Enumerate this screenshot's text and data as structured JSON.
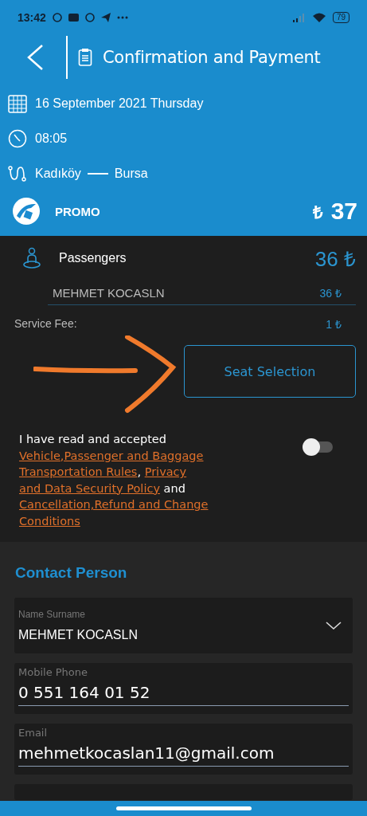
{
  "status_bar": {
    "time": "13:42",
    "battery": "79"
  },
  "header": {
    "title": "Confirmation and Payment"
  },
  "trip": {
    "date": "16 September 2021 Thursday",
    "time": "08:05",
    "from": "Kadıköy",
    "to": "Bursa"
  },
  "promo": {
    "label": "PROMO",
    "currency": "₺",
    "total": "37"
  },
  "passengers": {
    "label": "Passengers",
    "amount": "36 ₺",
    "items": [
      {
        "name": "MEHMET KOCASLN",
        "amount": "36 ₺"
      }
    ]
  },
  "service_fee": {
    "label": "Service Fee:",
    "amount": "1 ₺"
  },
  "seat_button": {
    "label": "Seat Selection"
  },
  "terms": {
    "on": false,
    "parts": [
      {
        "text": "I have read and accepted ",
        "link": false
      },
      {
        "text": "Vehicle,Passenger and Baggage",
        "link": true
      },
      {
        "text": "Transportation Rules",
        "link": true
      },
      {
        "text": ", ",
        "link": false
      },
      {
        "text": "Privacy",
        "link": true
      },
      {
        "text": "and Data Security Policy",
        "link": true
      },
      {
        "text": " and ",
        "link": false
      },
      {
        "text": "Cancellation,Refund and Change",
        "link": true
      },
      {
        "text": "Conditions",
        "link": true
      }
    ]
  },
  "contact": {
    "title": "Contact Person",
    "fields": [
      {
        "kind": "dropdown",
        "label": "Name Surname",
        "value": "MEHMET KOCASLN"
      },
      {
        "kind": "text",
        "label": "Mobile Phone",
        "value": "0 551 164 01 52"
      },
      {
        "kind": "text",
        "label": "Email",
        "value": "mehmetkocaslan11@gmail.com"
      }
    ]
  }
}
